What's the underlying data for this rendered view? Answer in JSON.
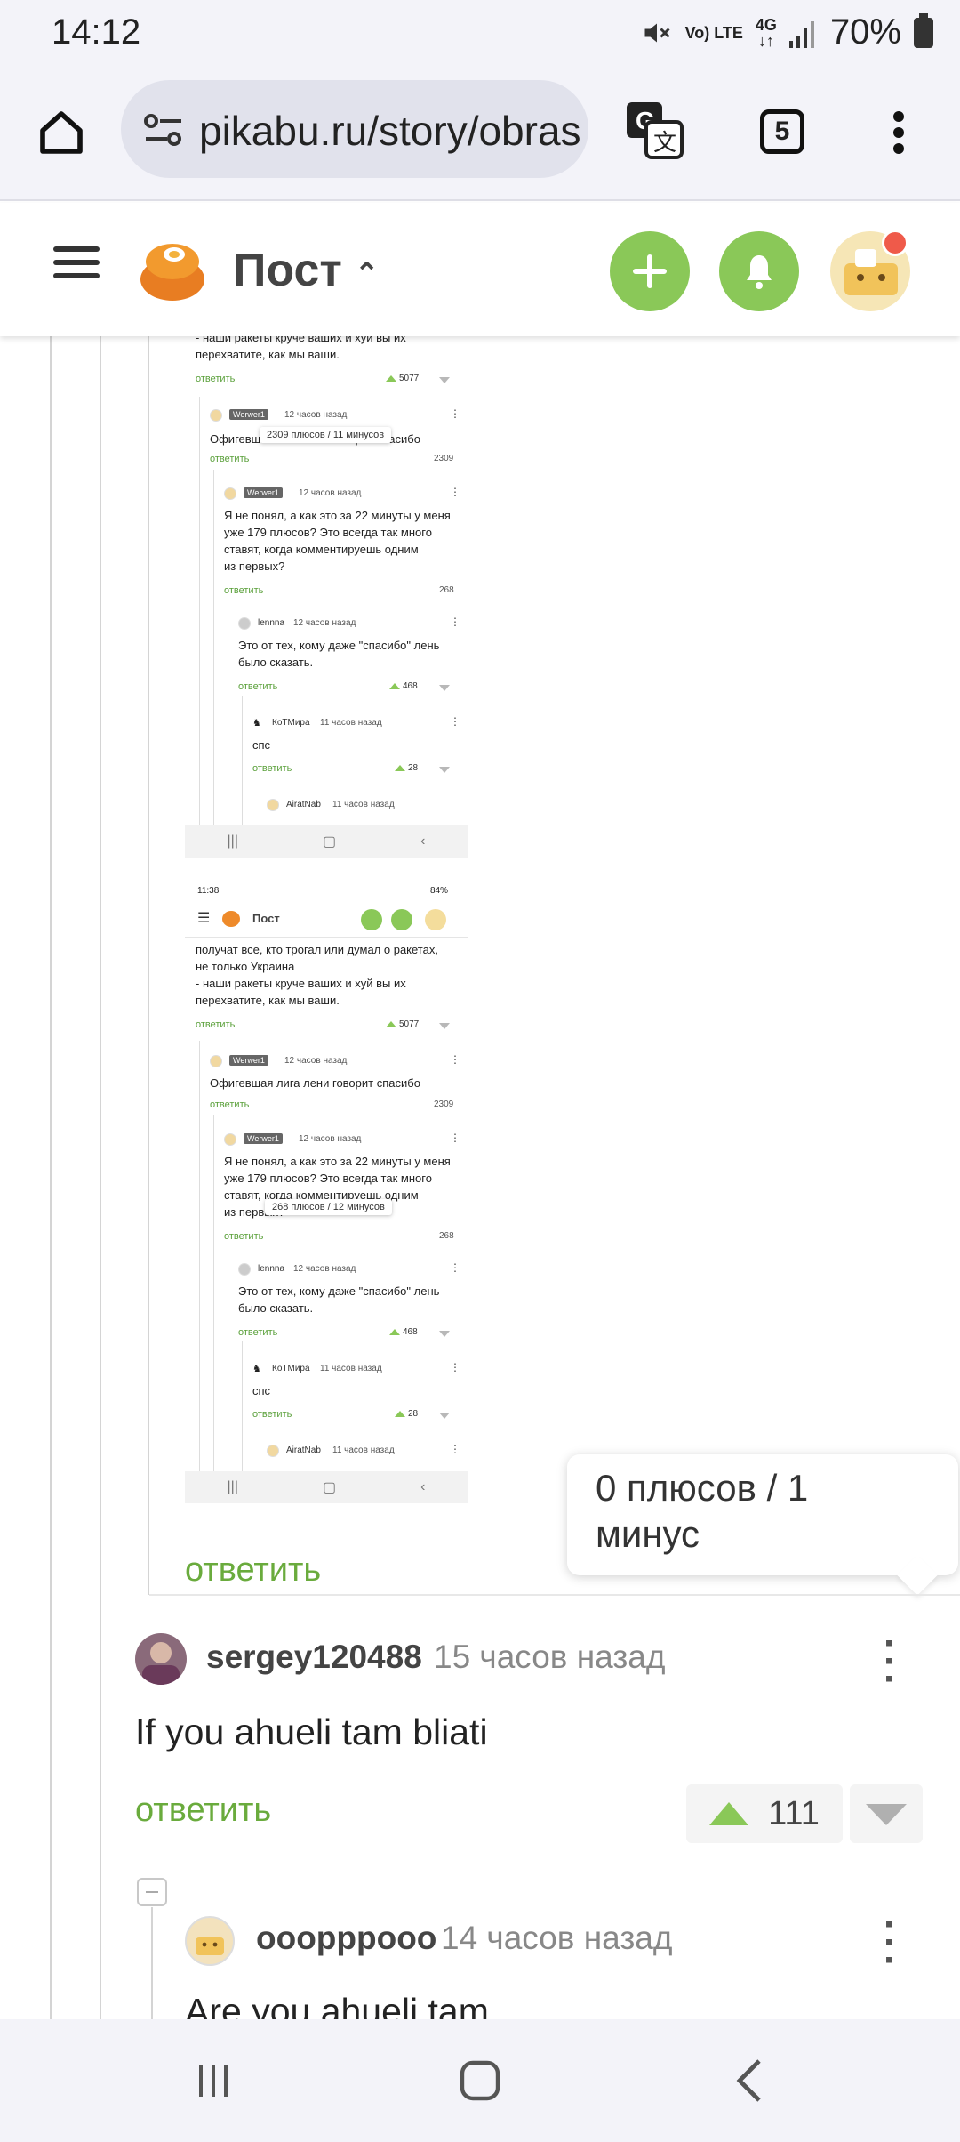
{
  "status_bar": {
    "time": "14:12",
    "network": "4G",
    "volte": "Vo) LTE",
    "battery": "70%"
  },
  "browser": {
    "url": "pikabu.ru/story/obras",
    "tab_count": "5"
  },
  "header": {
    "title": "Пост"
  },
  "screenshots": [
    {
      "comment_text": [
        "получат все, кто трогал или думал о ракетах,",
        "не только Украина",
        "- наши ракеты круче ваших и хуй вы их",
        "перехватите, как мы ваши."
      ],
      "reply_label": "ответить",
      "rating_1": "5077",
      "c2_user": "Werwer1",
      "c2_time": "12 часов назад",
      "c2_text": "Офигевшая лига лени говорит спасибо",
      "c2_rating": "2309",
      "c3_user": "Werwer1",
      "c3_time": "12 часов назад",
      "c3_text": [
        "Я не понял, а как это за 22 минуты у меня",
        "уже 179 плюсов? Это всегда так много",
        "ставят, когда комментируешь одним",
        "из первых?"
      ],
      "c3_rating": "268",
      "c4_user": "lennna",
      "c4_time": "12 часов назад",
      "c4_text": [
        "Это от тех, кому даже \"спасибо\" лень",
        "было сказать."
      ],
      "c4_rating": "468",
      "c5_user": "КоТМира",
      "c5_time": "11 часов назад",
      "c5_text": "спс",
      "c5_rating": "28",
      "c6_user": "AiratNab",
      "c6_time": "11 часов назад",
      "tooltip_1": "2309 плюсов / 11 минусов"
    },
    {
      "status_time": "11:38",
      "status_battery": "84%",
      "header_title": "Пост",
      "tooltip_2": "268 плюсов / 12 минусов"
    }
  ],
  "tooltip": {
    "line1": "0 плюсов / 1",
    "line2": "минус"
  },
  "reply_label": "ответить",
  "comment_1": {
    "user": "sergey120488",
    "time": "15 часов назад",
    "text": "If you ahueli tam bliati",
    "rating": "111"
  },
  "comment_2": {
    "user": "ooopppooo",
    "time": "14 часов назад",
    "text": "Are you ahueli tam"
  }
}
